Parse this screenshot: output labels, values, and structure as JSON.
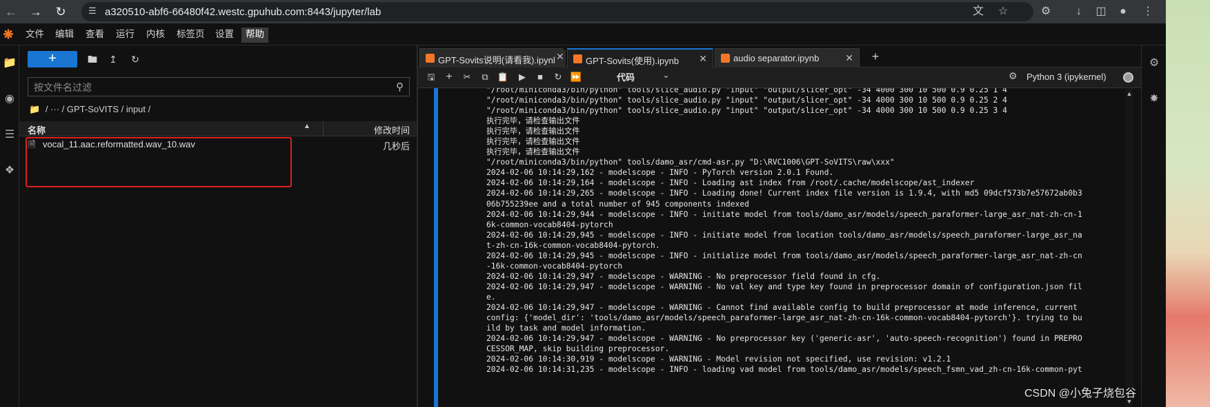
{
  "browser": {
    "url": "a320510-abf6-66480f42.westc.gpuhub.com:8443/jupyter/lab",
    "icons": [
      "back-icon",
      "forward-icon",
      "reload-icon",
      "site-info-icon",
      "translate-icon",
      "bookmark-star-icon",
      "extensions-icon",
      "download-icon",
      "side-panel-icon",
      "profile-icon",
      "more-icon"
    ]
  },
  "menu": {
    "items": [
      "文件",
      "编辑",
      "查看",
      "运行",
      "内核",
      "标签页",
      "设置",
      "帮助"
    ]
  },
  "filebrowser": {
    "new_label": "+",
    "filter_placeholder": "按文件名过滤",
    "breadcrumb": "/  ···  / GPT-SoVITS / input /",
    "col_name": "名称",
    "col_modified": "修改时间",
    "files": [
      {
        "name": "vocal_11.aac.reformatted.wav_10.wav",
        "modified": "几秒后"
      }
    ]
  },
  "tabs": [
    {
      "label": "GPT-Sovits说明(请看我).ipynb",
      "active": false
    },
    {
      "label": "GPT-Sovits(使用).ipynb",
      "active": true
    },
    {
      "label": "audio separator.ipynb",
      "active": false
    }
  ],
  "notebook": {
    "cell_type": "代码",
    "kernel_name": "Python 3 (ipykernel)"
  },
  "output_lines": [
    "\"/root/miniconda3/bin/python\" tools/slice_audio.py \"input\" \"output/slicer_opt\" -34 4000 300 10 500 0.9 0.25 1 4",
    "\"/root/miniconda3/bin/python\" tools/slice_audio.py \"input\" \"output/slicer_opt\" -34 4000 300 10 500 0.9 0.25 2 4",
    "\"/root/miniconda3/bin/python\" tools/slice_audio.py \"input\" \"output/slicer_opt\" -34 4000 300 10 500 0.9 0.25 3 4",
    "执行完毕，请检查输出文件",
    "执行完毕，请检查输出文件",
    "执行完毕，请检查输出文件",
    "执行完毕，请检查输出文件",
    "\"/root/miniconda3/bin/python\" tools/damo_asr/cmd-asr.py \"D:\\RVC1006\\GPT-SoVITS\\raw\\xxx\"",
    "2024-02-06 10:14:29,162 - modelscope - INFO - PyTorch version 2.0.1 Found.",
    "2024-02-06 10:14:29,164 - modelscope - INFO - Loading ast index from /root/.cache/modelscope/ast_indexer",
    "2024-02-06 10:14:29,265 - modelscope - INFO - Loading done! Current index file version is 1.9.4, with md5 09dcf573b7e57672ab0b3",
    "06b755239ee and a total number of 945 components indexed",
    "2024-02-06 10:14:29,944 - modelscope - INFO - initiate model from tools/damo_asr/models/speech_paraformer-large_asr_nat-zh-cn-1",
    "6k-common-vocab8404-pytorch",
    "2024-02-06 10:14:29,945 - modelscope - INFO - initiate model from location tools/damo_asr/models/speech_paraformer-large_asr_na",
    "t-zh-cn-16k-common-vocab8404-pytorch.",
    "2024-02-06 10:14:29,945 - modelscope - INFO - initialize model from tools/damo_asr/models/speech_paraformer-large_asr_nat-zh-cn",
    "-16k-common-vocab8404-pytorch",
    "2024-02-06 10:14:29,947 - modelscope - WARNING - No preprocessor field found in cfg.",
    "2024-02-06 10:14:29,947 - modelscope - WARNING - No val key and type key found in preprocessor domain of configuration.json fil",
    "e.",
    "2024-02-06 10:14:29,947 - modelscope - WARNING - Cannot find available config to build preprocessor at mode inference, current",
    "config: {'model_dir': 'tools/damo_asr/models/speech_paraformer-large_asr_nat-zh-cn-16k-common-vocab8404-pytorch'}. trying to bu",
    "ild by task and model information.",
    "2024-02-06 10:14:29,947 - modelscope - WARNING - No preprocessor key ('generic-asr', 'auto-speech-recognition') found in PREPRO",
    "CESSOR_MAP, skip building preprocessor.",
    "2024-02-06 10:14:30,919 - modelscope - WARNING - Model revision not specified, use revision: v1.2.1",
    "2024-02-06 10:14:31,235 - modelscope - INFO - loading vad model from tools/damo_asr/models/speech_fsmn_vad_zh-cn-16k-common-pyt"
  ],
  "watermark": "CSDN @小兔子烧包谷"
}
